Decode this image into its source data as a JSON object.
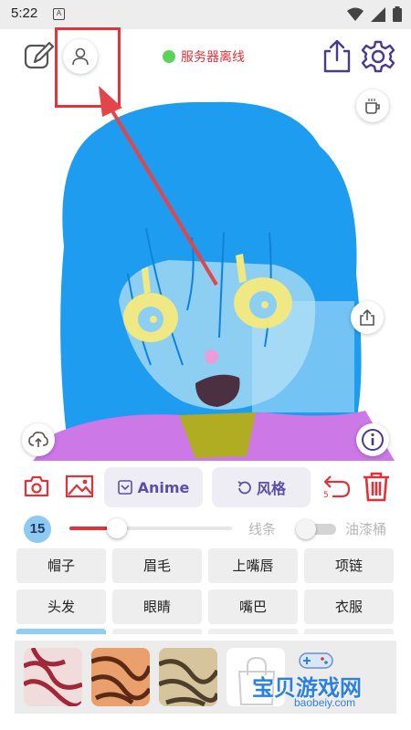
{
  "status_bar": {
    "time": "5:22",
    "notification_glyph": "A"
  },
  "header": {
    "server_status_text": "服务器离线",
    "server_status_color": "#5ad35a",
    "icons": [
      "edit-icon",
      "user-icon",
      "share-icon",
      "settings-icon"
    ]
  },
  "canvas": {
    "side_buttons": [
      "coffee-icon",
      "export-icon",
      "upload-icon",
      "info-icon"
    ]
  },
  "toolbar": {
    "anime_label": "Anime",
    "style_label": "风格",
    "undo_count": "5"
  },
  "brush": {
    "size": "15",
    "size_fraction": 0.29,
    "line_label": "线条",
    "bucket_label": "油漆桶",
    "bucket_enabled": false
  },
  "parts": [
    [
      "帽子",
      "眉毛",
      "上嘴唇",
      "项链"
    ],
    [
      "头发",
      "眼睛",
      "嘴巴",
      "衣服"
    ]
  ],
  "watermark": {
    "text": "宝贝游戏网",
    "url": "baobeiy.com"
  },
  "colors": {
    "accent_red": "#e0323a",
    "accent_purple": "#5c4ea8",
    "hair_blue": "#1e9cf0",
    "face_blue": "#8ccff2",
    "shirt_purple": "#cc78e6"
  }
}
